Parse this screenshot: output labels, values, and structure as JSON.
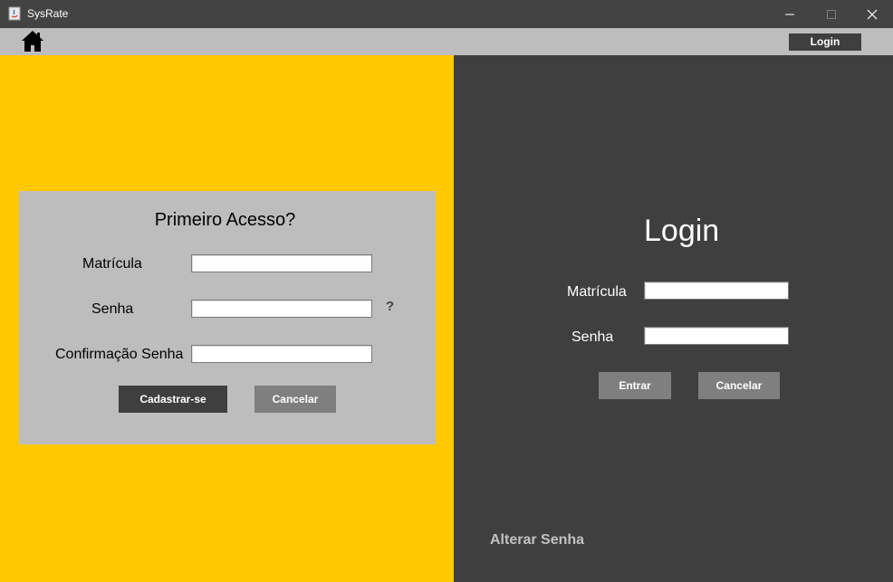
{
  "window": {
    "title": "SysRate"
  },
  "toolbar": {
    "login_label": "Login"
  },
  "first_access": {
    "title": "Primeiro Acesso?",
    "matricula_label": "Matrícula",
    "senha_label": "Senha",
    "confirm_label": "Confirmação Senha",
    "matricula_value": "",
    "senha_value": "",
    "confirm_value": "",
    "help": "?",
    "register_label": "Cadastrar-se",
    "cancel_label": "Cancelar"
  },
  "login": {
    "title": "Login",
    "matricula_label": "Matrícula",
    "senha_label": "Senha",
    "matricula_value": "",
    "senha_value": "",
    "enter_label": "Entrar",
    "cancel_label": "Cancelar",
    "alter_password_label": "Alterar Senha"
  },
  "colors": {
    "accent": "#ffc800",
    "dark": "#3f3f3f",
    "light_gray": "#bdbdbd",
    "button_gray": "#7f7f7f"
  },
  "icons": [
    "java-app-icon",
    "minimize-icon",
    "maximize-icon",
    "close-icon",
    "home-icon"
  ]
}
